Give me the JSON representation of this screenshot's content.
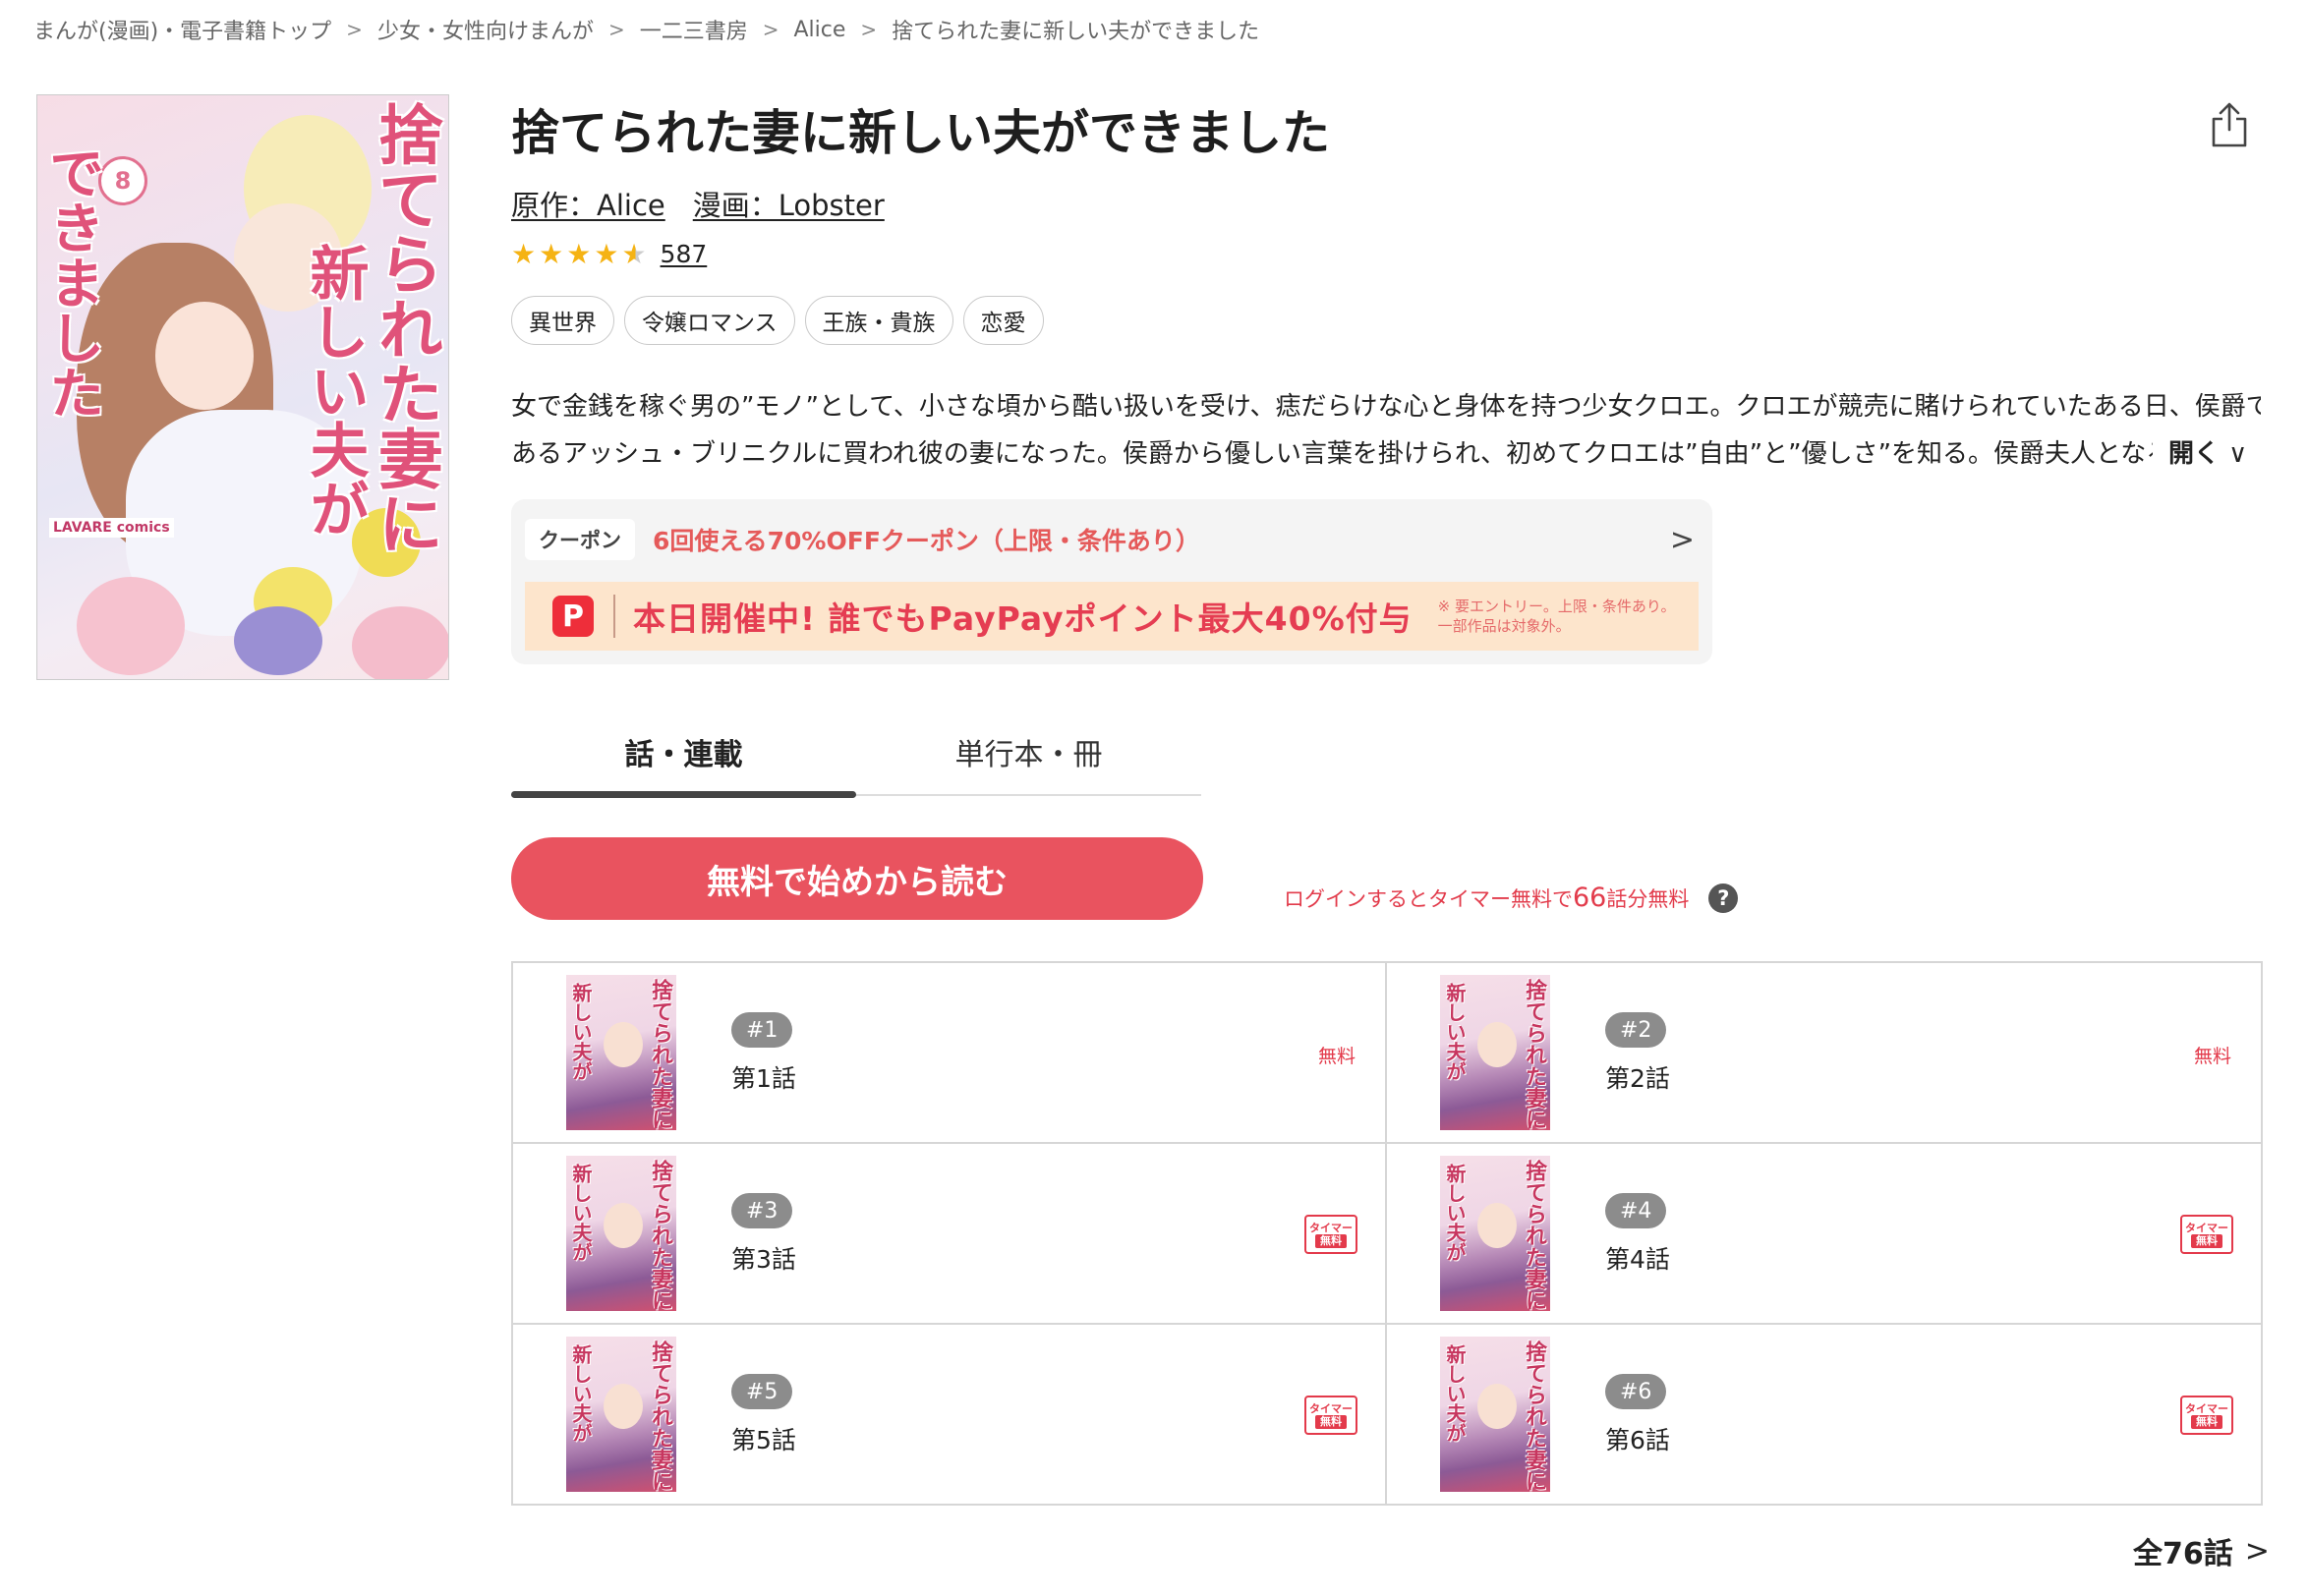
{
  "breadcrumb": [
    {
      "label": "まんが(漫画)・電子書籍トップ"
    },
    {
      "label": "少女・女性向けまんが"
    },
    {
      "label": "一二三書房"
    },
    {
      "label": "Alice"
    },
    {
      "label": "捨てられた妻に新しい夫ができました"
    }
  ],
  "cover": {
    "title_line1": "捨てられた妻に",
    "title_line2": "新しい夫が",
    "title_line3": "できました",
    "volume": "8",
    "label": "LAVARE comics"
  },
  "title": "捨てられた妻に新しい夫ができました",
  "authors": {
    "original": "原作：Alice",
    "art": "漫画：Lobster"
  },
  "rating": {
    "score": 4.5,
    "count": "587"
  },
  "tags": [
    "異世界",
    "令嬢ロマンス",
    "王族・貴族",
    "恋愛"
  ],
  "description": {
    "line1": "女で金銭を稼ぐ男の”モノ”として、小さな頃から酷い扱いを受け、痣だらけな心と身体を持つ少女クロエ。クロエが競売に賭けられていたある日、侯爵で",
    "line2": "あるアッシュ・ブリニクルに買われ彼の妻になった。侯爵から優しい言葉を掛けられ、初めてクロエは”自由”と”優しさ”を知る。侯爵夫人となる上",
    "open_label": "開く"
  },
  "coupon": {
    "label": "クーポン",
    "text": "6回使える70%OFFクーポン（上限・条件あり）",
    "paypay_text": "本日開催中! 誰でもPayPayポイント最大40%付与",
    "paypay_note1": "※ 要エントリー。上限・条件あり。",
    "paypay_note2": "一部作品は対象外。"
  },
  "tabs": [
    {
      "label": "話・連載",
      "active": true
    },
    {
      "label": "単行本・冊",
      "active": false
    }
  ],
  "read_button": "無料で始めから読む",
  "login_note": {
    "pre": "ログインするとタイマー無料で",
    "num": "66",
    "post": "話分無料"
  },
  "episodes": [
    {
      "num": "#1",
      "title": "第1話",
      "badge": "無料"
    },
    {
      "num": "#2",
      "title": "第2話",
      "badge": "無料"
    },
    {
      "num": "#3",
      "title": "第3話",
      "badge_top": "タイマー",
      "badge_bot": "無料"
    },
    {
      "num": "#4",
      "title": "第4話",
      "badge_top": "タイマー",
      "badge_bot": "無料"
    },
    {
      "num": "#5",
      "title": "第5話",
      "badge_top": "タイマー",
      "badge_bot": "無料"
    },
    {
      "num": "#6",
      "title": "第6話",
      "badge_top": "タイマー",
      "badge_bot": "無料"
    }
  ],
  "thumb_text": {
    "a": "捨てられた妻に",
    "b": "新しい夫が"
  },
  "all_episodes": "全76話",
  "colors": {
    "accent": "#e9535f",
    "star": "#f5b314",
    "free_red": "#e33a4b"
  }
}
